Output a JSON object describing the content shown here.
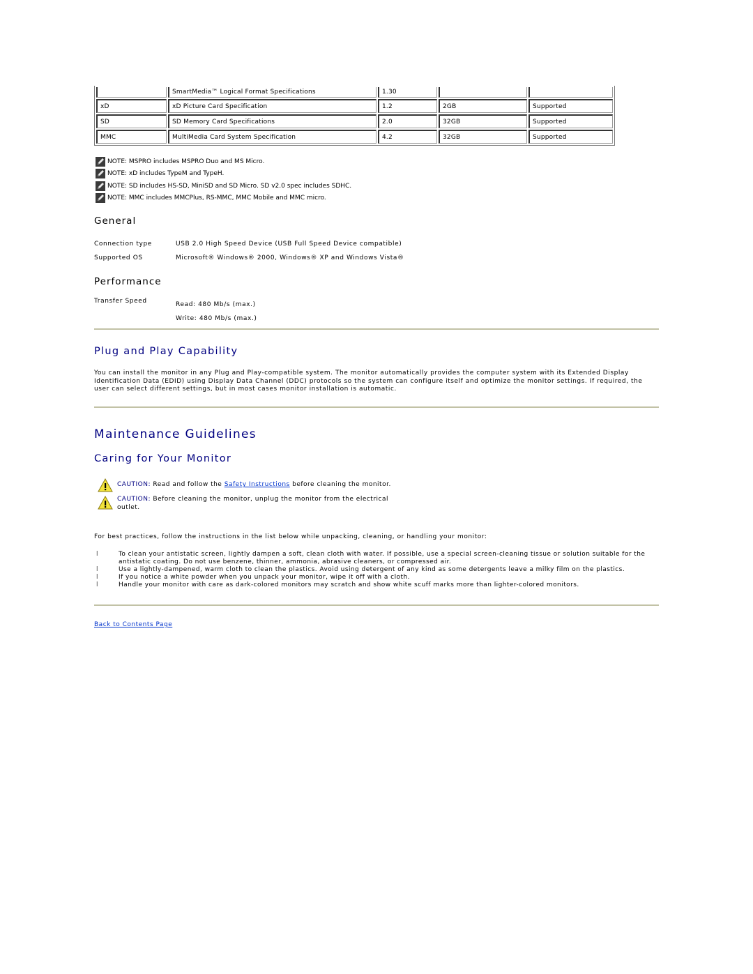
{
  "spec_table": {
    "rows": [
      {
        "card": "",
        "spec": "SmartMedia™ Logical Format Specifications",
        "version": "1.30",
        "capacity": "",
        "support": ""
      },
      {
        "card": "xD",
        "spec": "xD Picture Card Specification",
        "version": "1.2",
        "capacity": "2GB",
        "support": "Supported"
      },
      {
        "card": "SD",
        "spec": "SD Memory Card Specifications",
        "version": "2.0",
        "capacity": "32GB",
        "support": "Supported"
      },
      {
        "card": "MMC",
        "spec": "MultiMedia Card System Specification",
        "version": "4.2",
        "capacity": "32GB",
        "support": "Supported"
      }
    ]
  },
  "notes": [
    {
      "icon": "note-pencil-icon",
      "text": "NOTE: MSPRO includes MSPRO Duo and MS Micro."
    },
    {
      "icon": "note-pencil-icon",
      "text": "NOTE: xD includes TypeM and TypeH."
    },
    {
      "icon": "note-pencil-icon",
      "text": "NOTE: SD includes HS-SD, MiniSD and SD Micro. SD v2.0 spec includes SDHC."
    },
    {
      "icon": "note-pencil-icon",
      "text": "NOTE: MMC includes MMCPlus, RS-MMC, MMC Mobile and MMC micro."
    }
  ],
  "general": {
    "heading": "General",
    "connection_label": "Connection type",
    "connection_value": "USB 2.0 High Speed Device (USB Full Speed Device compatible)",
    "os_label": "Supported OS",
    "os_value": "Microsoft® Windows® 2000, Windows® XP and Windows Vista®"
  },
  "performance": {
    "heading": "Performance",
    "transfer_label": "Transfer Speed",
    "read": "Read: 480 Mb/s (max.)",
    "write": "Write: 480 Mb/s (max.)"
  },
  "plug_and_play": {
    "heading": "Plug and Play Capability",
    "body": "You can install the monitor in any Plug and Play-compatible system. The monitor automatically provides the computer system with its Extended Display Identification Data (EDID) using Display Data Channel (DDC) protocols so the system can configure itself and optimize the monitor settings. If required, the user can select different settings, but in most cases monitor installation is automatic."
  },
  "maintenance": {
    "heading": "Maintenance Guidelines",
    "subheading": "Caring for Your Monitor",
    "caution1": {
      "label": "CAUTION:",
      "before": "Read and follow the",
      "link": "Safety Instructions",
      "after": "before cleaning the monitor."
    },
    "caution2": {
      "label": "CAUTION:",
      "text": "Before cleaning the monitor, unplug the monitor from the electrical outlet."
    },
    "intro": "For best practices, follow the instructions in the list below while unpacking, cleaning, or handling your monitor:",
    "bullet_mark": "l",
    "bullets": [
      "To clean your antistatic screen, lightly dampen a soft, clean cloth with water. If possible, use a special screen-cleaning tissue or solution suitable for the antistatic coating. Do not use benzene, thinner, ammonia, abrasive cleaners, or compressed air.",
      "Use a lightly-dampened, warm cloth to clean the plastics. Avoid using detergent of any kind as some detergents leave a milky film on the plastics.",
      "If you notice a white powder when you unpack your monitor, wipe it off with a cloth.",
      "Handle your  monitor with care as dark-colored monitors may scratch and show white scuff marks more than lighter-colored monitors."
    ]
  },
  "footer": {
    "back_link": "Back to Contents Page"
  },
  "colors": {
    "heading_blue": "#000080",
    "link_blue": "#0033cc",
    "rule": "#c2c2a6"
  }
}
